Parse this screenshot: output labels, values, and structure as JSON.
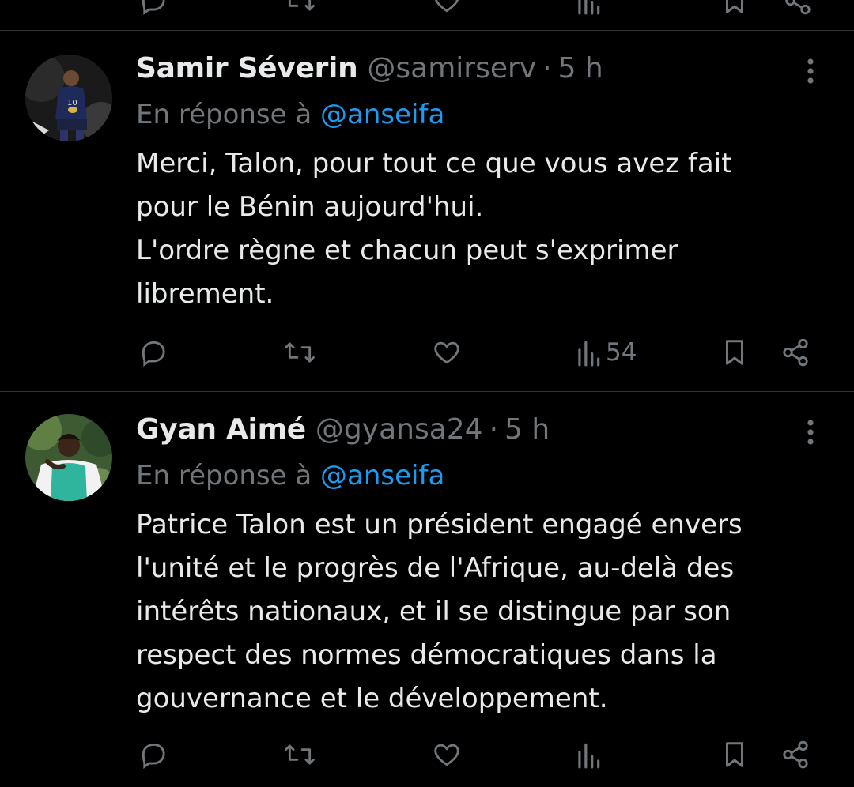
{
  "colors": {
    "background": "#000000",
    "text_primary": "#e7e9ea",
    "text_secondary": "#71767b",
    "accent": "#1d9bf0",
    "divider": "#2f3336"
  },
  "tweets": [
    {
      "author_name": "Samir Séverin",
      "handle": "@samirserv",
      "separator": "·",
      "time": "5 h",
      "reply_prefix": "En réponse à",
      "reply_to": "@anseifa",
      "body_lines": [
        "Merci, Talon, pour tout ce que vous avez fait",
        "pour le Bénin aujourd'hui.",
        "L'ordre règne et chacun peut s'exprimer",
        "librement."
      ],
      "views": "54",
      "avatar_icon": "avatar-football-player"
    },
    {
      "author_name": "Gyan Aimé",
      "handle": "@gyansa24",
      "separator": "·",
      "time": "5 h",
      "reply_prefix": "En réponse à",
      "reply_to": "@anseifa",
      "body_lines": [
        "Patrice Talon est un président engagé envers",
        "l'unité et le progrès de l'Afrique, au-delà des",
        "intérêts nationaux, et il se distingue par son",
        "respect des normes démocratiques dans la",
        "gouvernance et le développement."
      ],
      "avatar_icon": "avatar-person-green-vest"
    }
  ],
  "icons": {
    "reply": "reply-icon",
    "retweet": "retweet-icon",
    "like": "heart-icon",
    "views": "views-icon",
    "bookmark": "bookmark-icon",
    "share": "share-icon",
    "more": "more-icon"
  }
}
